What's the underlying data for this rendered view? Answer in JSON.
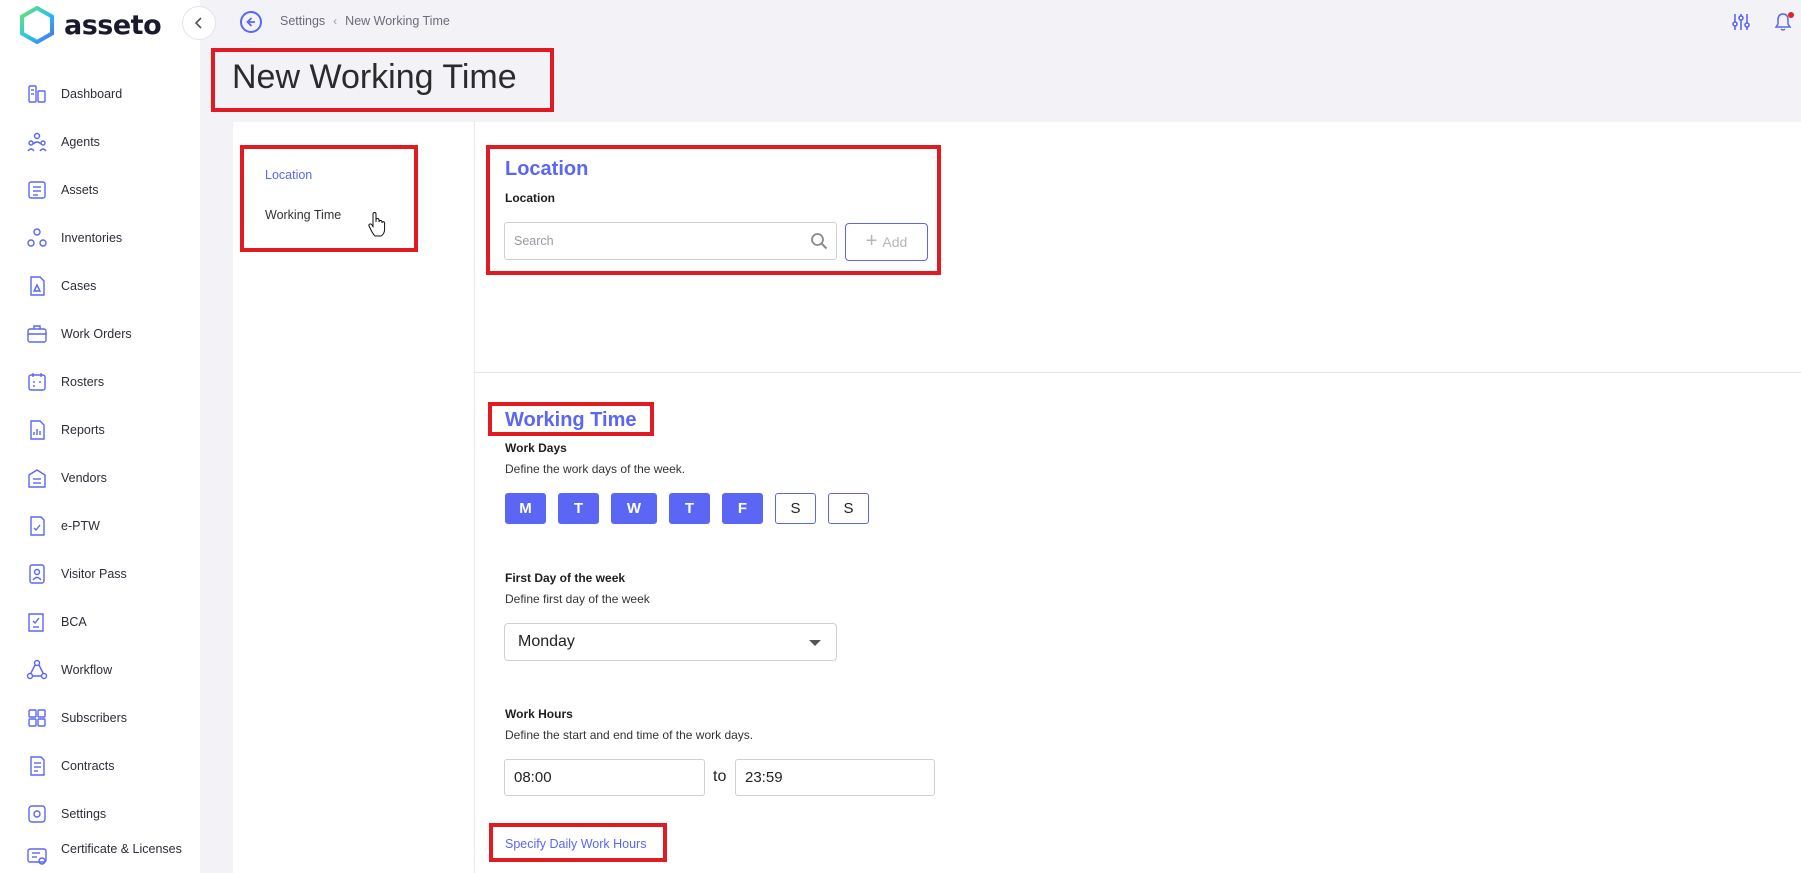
{
  "app": {
    "name": "asseto"
  },
  "sidebar": {
    "items": [
      {
        "label": "Dashboard",
        "icon": "dashboard-icon"
      },
      {
        "label": "Agents",
        "icon": "agents-icon"
      },
      {
        "label": "Assets",
        "icon": "assets-icon"
      },
      {
        "label": "Inventories",
        "icon": "inventories-icon"
      },
      {
        "label": "Cases",
        "icon": "cases-icon"
      },
      {
        "label": "Work Orders",
        "icon": "work-orders-icon"
      },
      {
        "label": "Rosters",
        "icon": "rosters-icon"
      },
      {
        "label": "Reports",
        "icon": "reports-icon"
      },
      {
        "label": "Vendors",
        "icon": "vendors-icon"
      },
      {
        "label": "e-PTW",
        "icon": "eptw-icon"
      },
      {
        "label": "Visitor Pass",
        "icon": "visitor-pass-icon"
      },
      {
        "label": "BCA",
        "icon": "bca-icon"
      },
      {
        "label": "Workflow",
        "icon": "workflow-icon"
      },
      {
        "label": "Subscribers",
        "icon": "subscribers-icon"
      },
      {
        "label": "Contracts",
        "icon": "contracts-icon"
      },
      {
        "label": "Settings",
        "icon": "settings-icon"
      },
      {
        "label": "Certificate & Licenses",
        "icon": "certificate-icon"
      }
    ]
  },
  "breadcrumb": {
    "parent": "Settings",
    "current": "New Working Time"
  },
  "page": {
    "title": "New Working Time"
  },
  "side_nav": {
    "location": "Location",
    "working_time": "Working Time"
  },
  "location_section": {
    "title": "Location",
    "field_label": "Location",
    "search_placeholder": "Search",
    "add_label": "Add"
  },
  "working_time_section": {
    "title": "Working Time",
    "work_days_label": "Work Days",
    "work_days_help": "Define the work days of the week.",
    "days": [
      {
        "label": "M",
        "selected": true
      },
      {
        "label": "T",
        "selected": true
      },
      {
        "label": "W",
        "selected": true
      },
      {
        "label": "T",
        "selected": true
      },
      {
        "label": "F",
        "selected": true
      },
      {
        "label": "S",
        "selected": false
      },
      {
        "label": "S",
        "selected": false
      }
    ],
    "first_day_label": "First Day of the week",
    "first_day_help": "Define first day of the week",
    "first_day_value": "Monday",
    "work_hours_label": "Work Hours",
    "work_hours_help": "Define the start and end time of the work days.",
    "start_time": "08:00",
    "to_word": "to",
    "end_time": "23:59",
    "specify_link": "Specify Daily Work Hours"
  },
  "colors": {
    "accent": "#5b66f5",
    "highlight": "#e11b22",
    "background": "#f2f2f7"
  }
}
